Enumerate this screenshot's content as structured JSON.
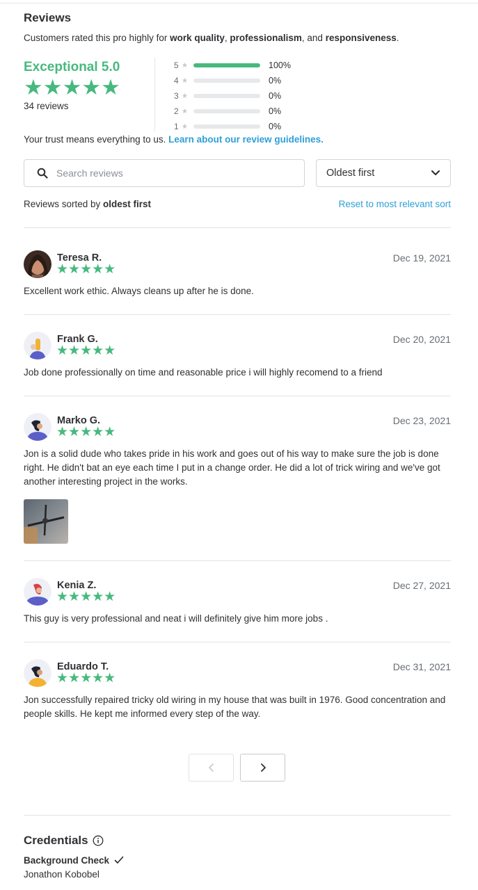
{
  "reviews_section": {
    "title": "Reviews",
    "subtitle_prefix": "Customers rated this pro highly for ",
    "subtitle_trait1": "work quality",
    "subtitle_sep1": ", ",
    "subtitle_trait2": "professionalism",
    "subtitle_sep2": ", and ",
    "subtitle_trait3": "responsiveness",
    "subtitle_suffix": ".",
    "rating_label": "Exceptional 5.0",
    "rating_value": 5.0,
    "stars_text": "★★★★★",
    "review_count": "34 reviews",
    "distribution": [
      {
        "stars": "5",
        "percent": "100%",
        "fraction": 1.0
      },
      {
        "stars": "4",
        "percent": "0%",
        "fraction": 0
      },
      {
        "stars": "3",
        "percent": "0%",
        "fraction": 0
      },
      {
        "stars": "2",
        "percent": "0%",
        "fraction": 0
      },
      {
        "stars": "1",
        "percent": "0%",
        "fraction": 0
      }
    ],
    "trust_text": "Your trust means everything to us. ",
    "trust_link": "Learn about our review guidelines.",
    "search_placeholder": "Search reviews",
    "sort_selected": "Oldest first",
    "sorted_by_prefix": "Reviews sorted by ",
    "sorted_by_value": "oldest first",
    "reset_link": "Reset to most relevant sort"
  },
  "reviews": [
    {
      "name": "Teresa R.",
      "date": "Dec 19, 2021",
      "stars": "★★★★★",
      "text": "Excellent work ethic. Always cleans up after he is done."
    },
    {
      "name": "Frank G.",
      "date": "Dec 20, 2021",
      "stars": "★★★★★",
      "text": "Job done professionally on time and reasonable price i will highly recomend to a friend"
    },
    {
      "name": "Marko G.",
      "date": "Dec 23, 2021",
      "stars": "★★★★★",
      "text": "Jon is a solid dude who takes pride in his work and goes out of his way to make sure the job is done right. He didn't bat an eye each time I put in a change order. He did a lot of trick wiring and we've got another interesting project in the works."
    },
    {
      "name": "Kenia Z.",
      "date": "Dec 27, 2021",
      "stars": "★★★★★",
      "text": "This guy is very professional and neat i will definitely give him more jobs ."
    },
    {
      "name": "Eduardo T.",
      "date": "Dec 31, 2021",
      "stars": "★★★★★",
      "text": "Jon successfully repaired tricky old wiring in my house that was built in 1976. Good concentration and people skills. He kept me informed every step of the way."
    }
  ],
  "pagination": {
    "prev_icon": "chevron-left-icon",
    "next_icon": "chevron-right-icon",
    "prev_disabled": true
  },
  "credentials": {
    "title": "Credentials",
    "info_icon": "info-icon",
    "background_check_label": "Background Check",
    "check_icon": "checkmark-icon",
    "background_check_name": "Jonathon Kobobel"
  },
  "colors": {
    "accent_green": "#47b97e",
    "link_blue": "#2d9fd6",
    "text": "#2f3033"
  }
}
